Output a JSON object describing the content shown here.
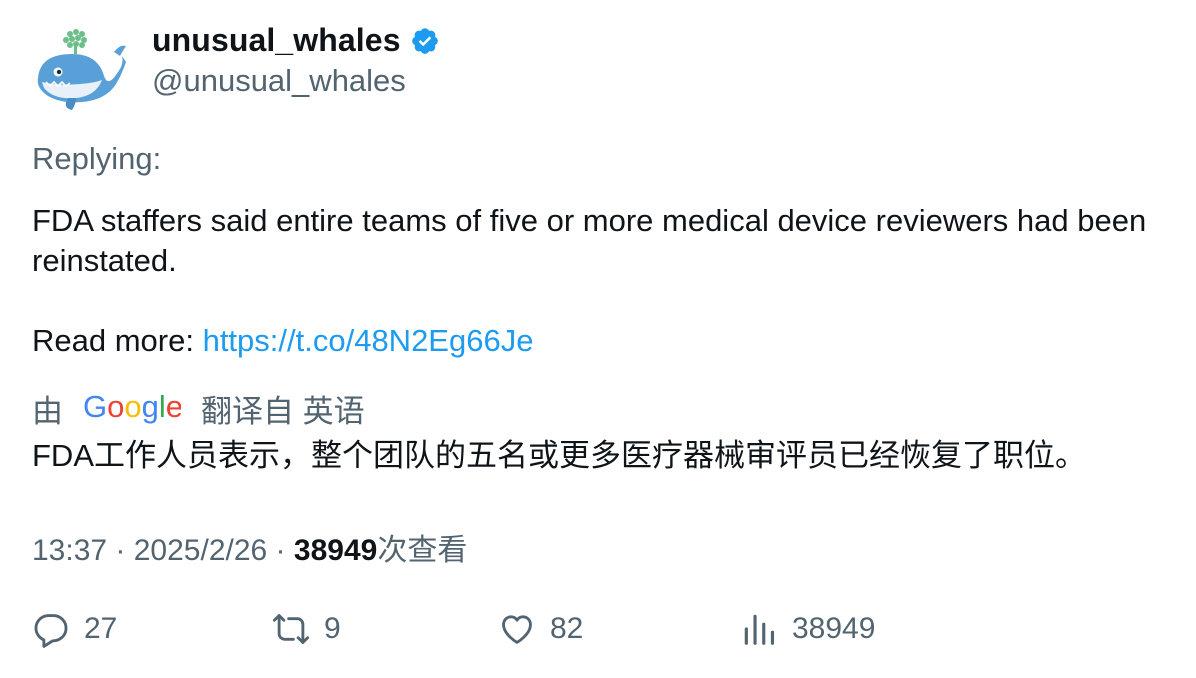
{
  "author": {
    "display_name": "unusual_whales",
    "handle": "@unusual_whales",
    "verified": true,
    "avatar_icon": "whale-avatar-icon",
    "verified_color": "#1d9bf0"
  },
  "tweet": {
    "replying_label": "Replying:",
    "body": "FDA staffers said entire teams of five or more medical device reviewers had been reinstated.",
    "read_more_label": "Read more: ",
    "link": "https://t.co/48N2Eg66Je",
    "link_color": "#1d9bf0"
  },
  "translation": {
    "prefix": "由",
    "provider_logo_text": "Google",
    "suffix": "翻译自 英语",
    "text": "FDA工作人员表示，整个团队的五名或更多医疗器械审评员已经恢复了职位。"
  },
  "meta": {
    "time": "13:37",
    "separator1": " · ",
    "date": "2025/2/26",
    "separator2": " · ",
    "views_count": "38949",
    "views_label": "次查看"
  },
  "actions": {
    "reply_count": "27",
    "retweet_count": "9",
    "like_count": "82",
    "views_count": "38949"
  }
}
